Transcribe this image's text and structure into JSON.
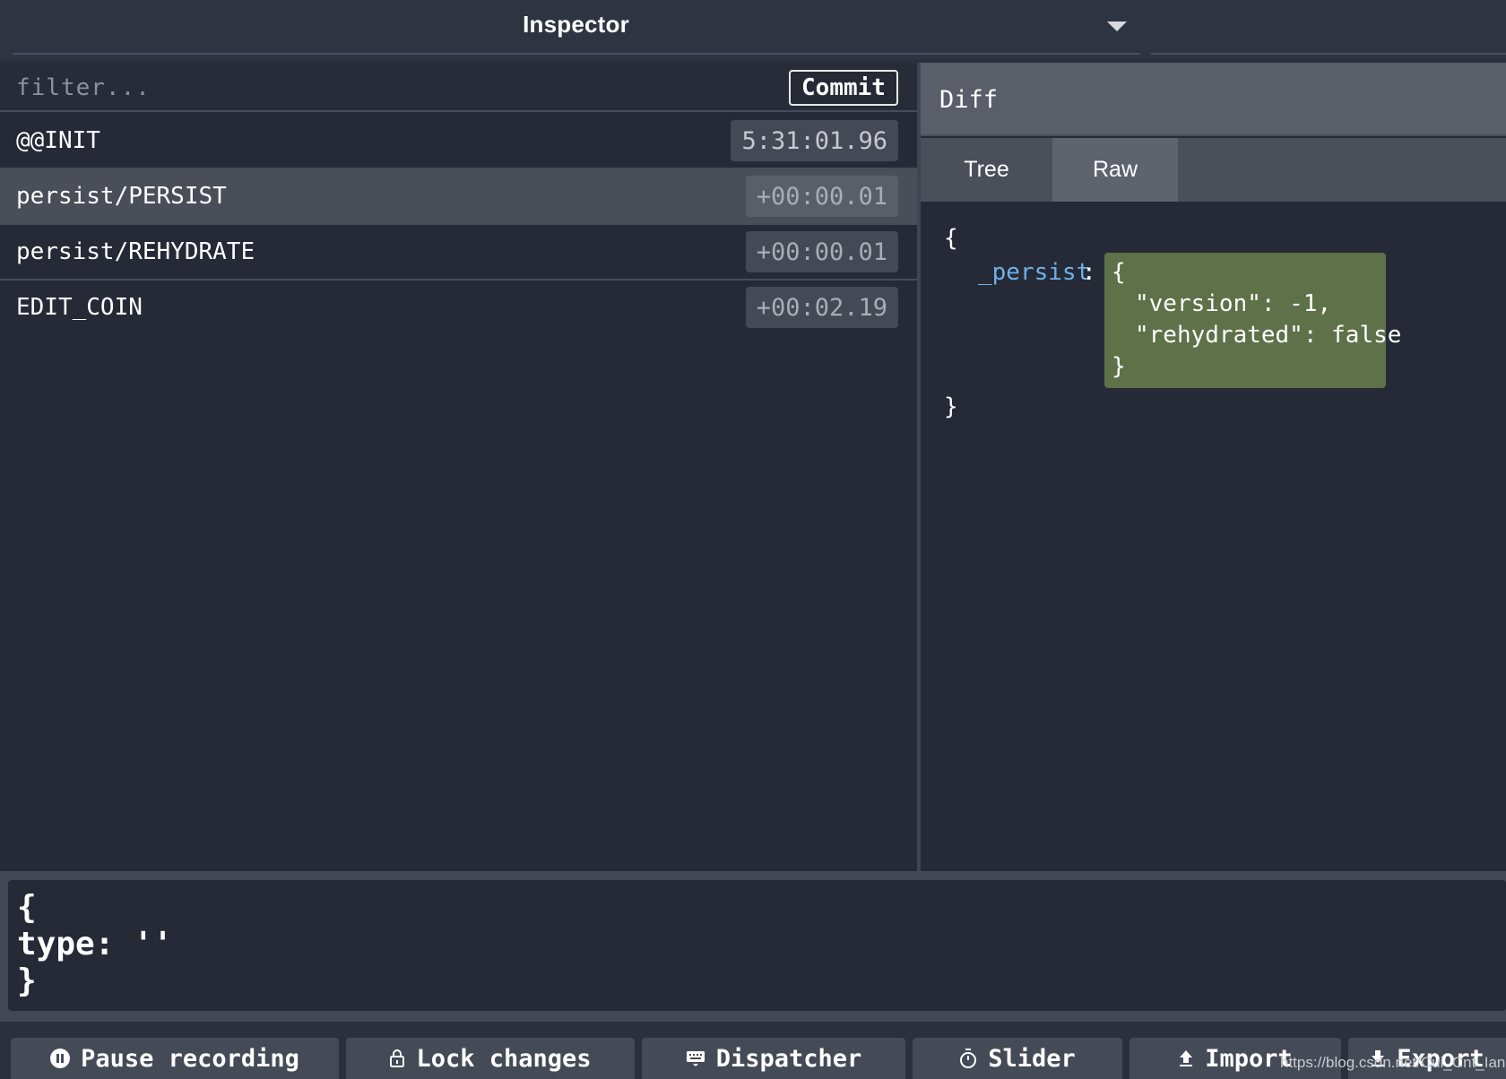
{
  "header": {
    "title": "Inspector"
  },
  "filter": {
    "placeholder": "filter...",
    "commit_label": "Commit"
  },
  "actions": [
    {
      "name": "@@INIT",
      "time": "5:31:01.96"
    },
    {
      "name": "persist/PERSIST",
      "time": "+00:00.01"
    },
    {
      "name": "persist/REHYDRATE",
      "time": "+00:00.01"
    },
    {
      "name": "EDIT_COIN",
      "time": "+00:02.19"
    }
  ],
  "diff": {
    "header": "Diff",
    "tabs": [
      "Tree",
      "Raw"
    ],
    "active_tab": "Raw",
    "lines": {
      "open": "{",
      "key": "_persist",
      "colon": ":",
      "obj_open": "{",
      "version": "\"version\": -1,",
      "rehydrated": "\"rehydrated\": false",
      "obj_close": "}",
      "close": "}"
    }
  },
  "editor": {
    "content": "{\ntype: ''\n}"
  },
  "buttons": {
    "pause": "Pause recording",
    "lock": "Lock changes",
    "dispatcher": "Dispatcher",
    "slider": "Slider",
    "import": "Import",
    "export": "Export"
  },
  "watermark": "https://blog.csdn.net/Cui_Cnt_Ian",
  "colors": {
    "background": "#262a36",
    "accent_key": "#6fb2e8",
    "diff_added": "#5f7148"
  }
}
